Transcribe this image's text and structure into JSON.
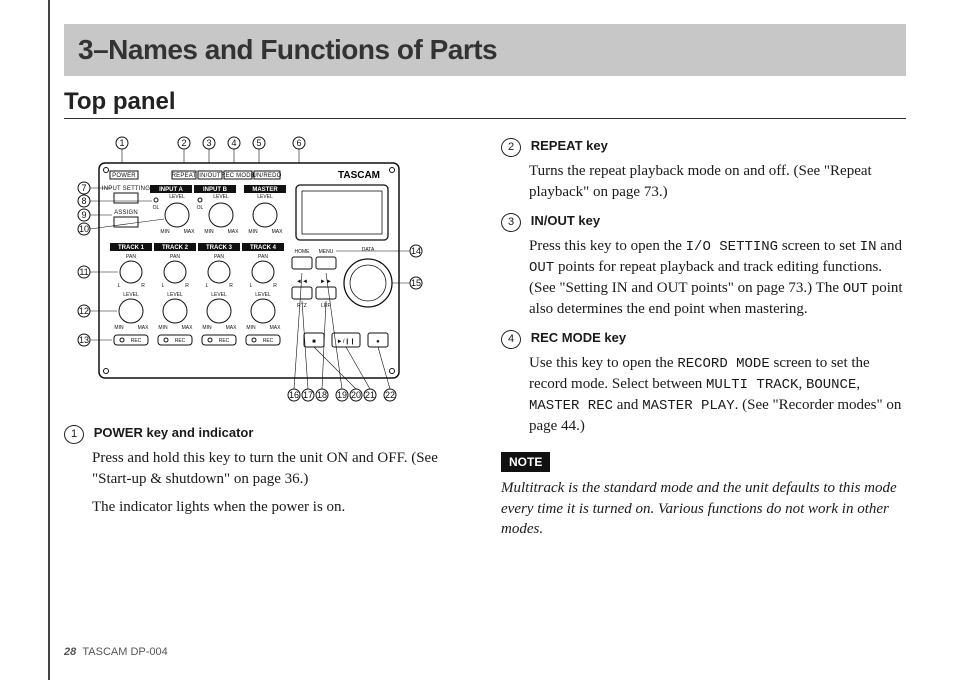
{
  "chapter": {
    "title": "3–Names and Functions of Parts"
  },
  "section": {
    "title": "Top panel"
  },
  "diagram": {
    "brand": "TASCAM",
    "keys": {
      "power": "POWER",
      "repeat": "REPEAT",
      "inout": "IN/OUT",
      "recmode": "REC MODE",
      "unredo": "UN/REDO"
    },
    "input_setting": "INPUT SETTING",
    "assign": "ASSIGN",
    "blocks": {
      "input_a": "INPUT A",
      "input_b": "INPUT B",
      "master": "MASTER"
    },
    "level": "LEVEL",
    "ol": "OL",
    "min": "MIN",
    "max": "MAX",
    "tracks": [
      "TRACK 1",
      "TRACK 2",
      "TRACK 3",
      "TRACK 4"
    ],
    "pan": "PAN",
    "l": "L",
    "r": "R",
    "rec": "REC",
    "home": "HOME",
    "menu": "MENU",
    "data": "DATA",
    "rtz": "RTZ",
    "lrp": "LRP",
    "transport": {
      "rew": "◄◄",
      "ff": "►►",
      "play": "►",
      "playpause": "►/❙❙",
      "stop": "■",
      "rec": "●"
    },
    "callouts": {
      "1": "1",
      "2": "2",
      "3": "3",
      "4": "4",
      "5": "5",
      "6": "6",
      "7": "7",
      "8": "8",
      "9": "9",
      "10": "10",
      "11": "11",
      "12": "12",
      "13": "13",
      "14": "14",
      "15": "15",
      "16": "16",
      "17": "17",
      "18": "18",
      "19": "19",
      "20": "20",
      "21": "21",
      "22": "22"
    }
  },
  "items": {
    "i1": {
      "num": "1",
      "label": "POWER key and indicator",
      "body_a": "Press and hold this key to turn the unit ON and OFF. (See \"Start-up & shutdown\" on page 36.)",
      "body_b": "The indicator lights when the power is on."
    },
    "i2": {
      "num": "2",
      "label": "REPEAT key",
      "body": "Turns the repeat playback mode on and off. (See \"Repeat playback\" on page 73.)"
    },
    "i3": {
      "num": "3",
      "label": "IN/OUT key",
      "body_pre": "Press this key to open the ",
      "mono_a": "I/O SETTING",
      "body_mid1": " screen to set ",
      "mono_b": "IN",
      "body_mid2": " and ",
      "mono_c": "OUT",
      "body_mid3": " points for repeat playback and track editing functions. (See \"Setting IN and OUT points\" on page 73.) The ",
      "mono_d": "OUT",
      "body_post": " point also determines the end point when mastering."
    },
    "i4": {
      "num": "4",
      "label": "REC MODE key",
      "body_pre": "Use this key to open the ",
      "mono_a": "RECORD MODE",
      "body_mid1": " screen to set the record mode. Select between ",
      "mono_b": "MULTI TRACK",
      "sep1": ", ",
      "mono_c": "BOUNCE",
      "sep2": ", ",
      "mono_d": "MASTER REC",
      "sep3": " and ",
      "mono_e": "MASTER PLAY",
      "body_post": ". (See \"Recorder modes\" on page 44.)"
    }
  },
  "note": {
    "badge": "NOTE",
    "text": "Multitrack is the standard mode and the unit defaults to this mode every time it is turned on. Various functions do not work in other modes."
  },
  "footer": {
    "page": "28",
    "product": "TASCAM  DP-004"
  }
}
